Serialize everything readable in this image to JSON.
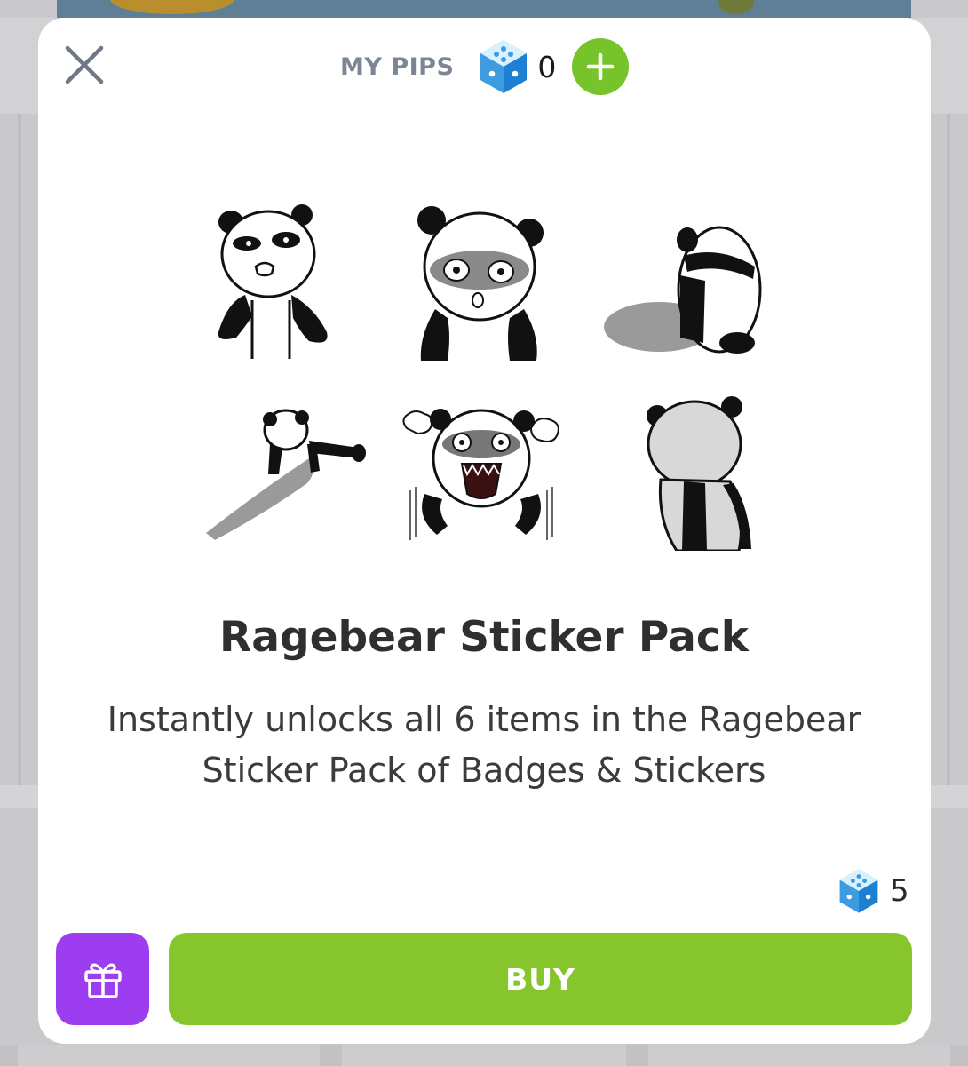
{
  "header": {
    "pips_label": "MY PIPS",
    "pips_count": "0",
    "close_icon": "close-icon",
    "add_icon": "plus-icon",
    "pip_icon": "pip-dice-icon"
  },
  "stickers": {
    "count": 6,
    "items": [
      "grumpy-panda",
      "scared-panda",
      "sulking-panda-back",
      "crawling-panda",
      "raging-panda",
      "panda-back-view"
    ]
  },
  "product": {
    "title": "Ragebear Sticker Pack",
    "description": "Instantly unlocks all 6 items in the Ragebear Sticker Pack of Badges & Stickers",
    "price": "5"
  },
  "actions": {
    "gift_icon": "gift-icon",
    "buy_label": "BUY"
  },
  "colors": {
    "buy": "#86c52c",
    "gift": "#9d3df0",
    "add": "#77c42a",
    "pips_label": "#7c8593"
  }
}
